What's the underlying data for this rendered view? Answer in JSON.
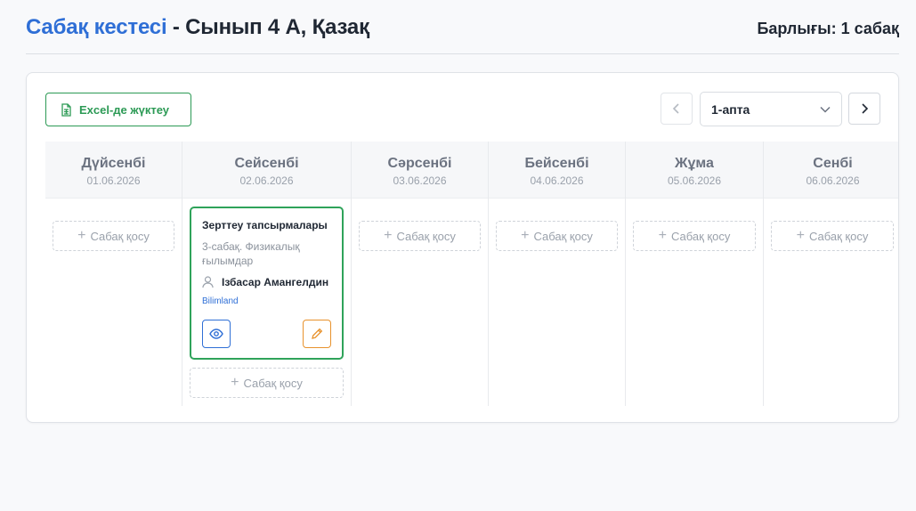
{
  "header": {
    "title_accent": "Сабақ кестесі",
    "title_rest": " - Сынып 4 А, Қазақ",
    "total": "Барлығы: 1 сабақ"
  },
  "toolbar": {
    "excel_label": "Excel-де жүктеу",
    "week_value": "1-апта"
  },
  "days": [
    {
      "name": "Дүйсенбі",
      "date": "01.06.2026"
    },
    {
      "name": "Сейсенбі",
      "date": "02.06.2026"
    },
    {
      "name": "Сәрсенбі",
      "date": "03.06.2026"
    },
    {
      "name": "Бейсенбі",
      "date": "04.06.2026"
    },
    {
      "name": "Жұма",
      "date": "05.06.2026"
    },
    {
      "name": "Сенбі",
      "date": "06.06.2026"
    }
  ],
  "add_label": "Сабақ қосу",
  "lesson": {
    "title": "Зерттеу тапсырмалары",
    "subtitle": "3-сабақ. Физикалық ғылымдар",
    "teacher": "Ізбасар Амангелдин",
    "provider": "Bilimland"
  },
  "colors": {
    "accent_blue": "#2f6fd6",
    "green": "#2c9a55",
    "orange": "#e8922c"
  },
  "icons": {
    "excel": "spreadsheet-icon",
    "prev": "chevron-left-icon",
    "next": "chevron-right-icon",
    "select": "chevron-down-icon",
    "teacher": "user-icon",
    "view": "eye-icon",
    "edit": "pencil-icon",
    "add": "plus-icon"
  }
}
